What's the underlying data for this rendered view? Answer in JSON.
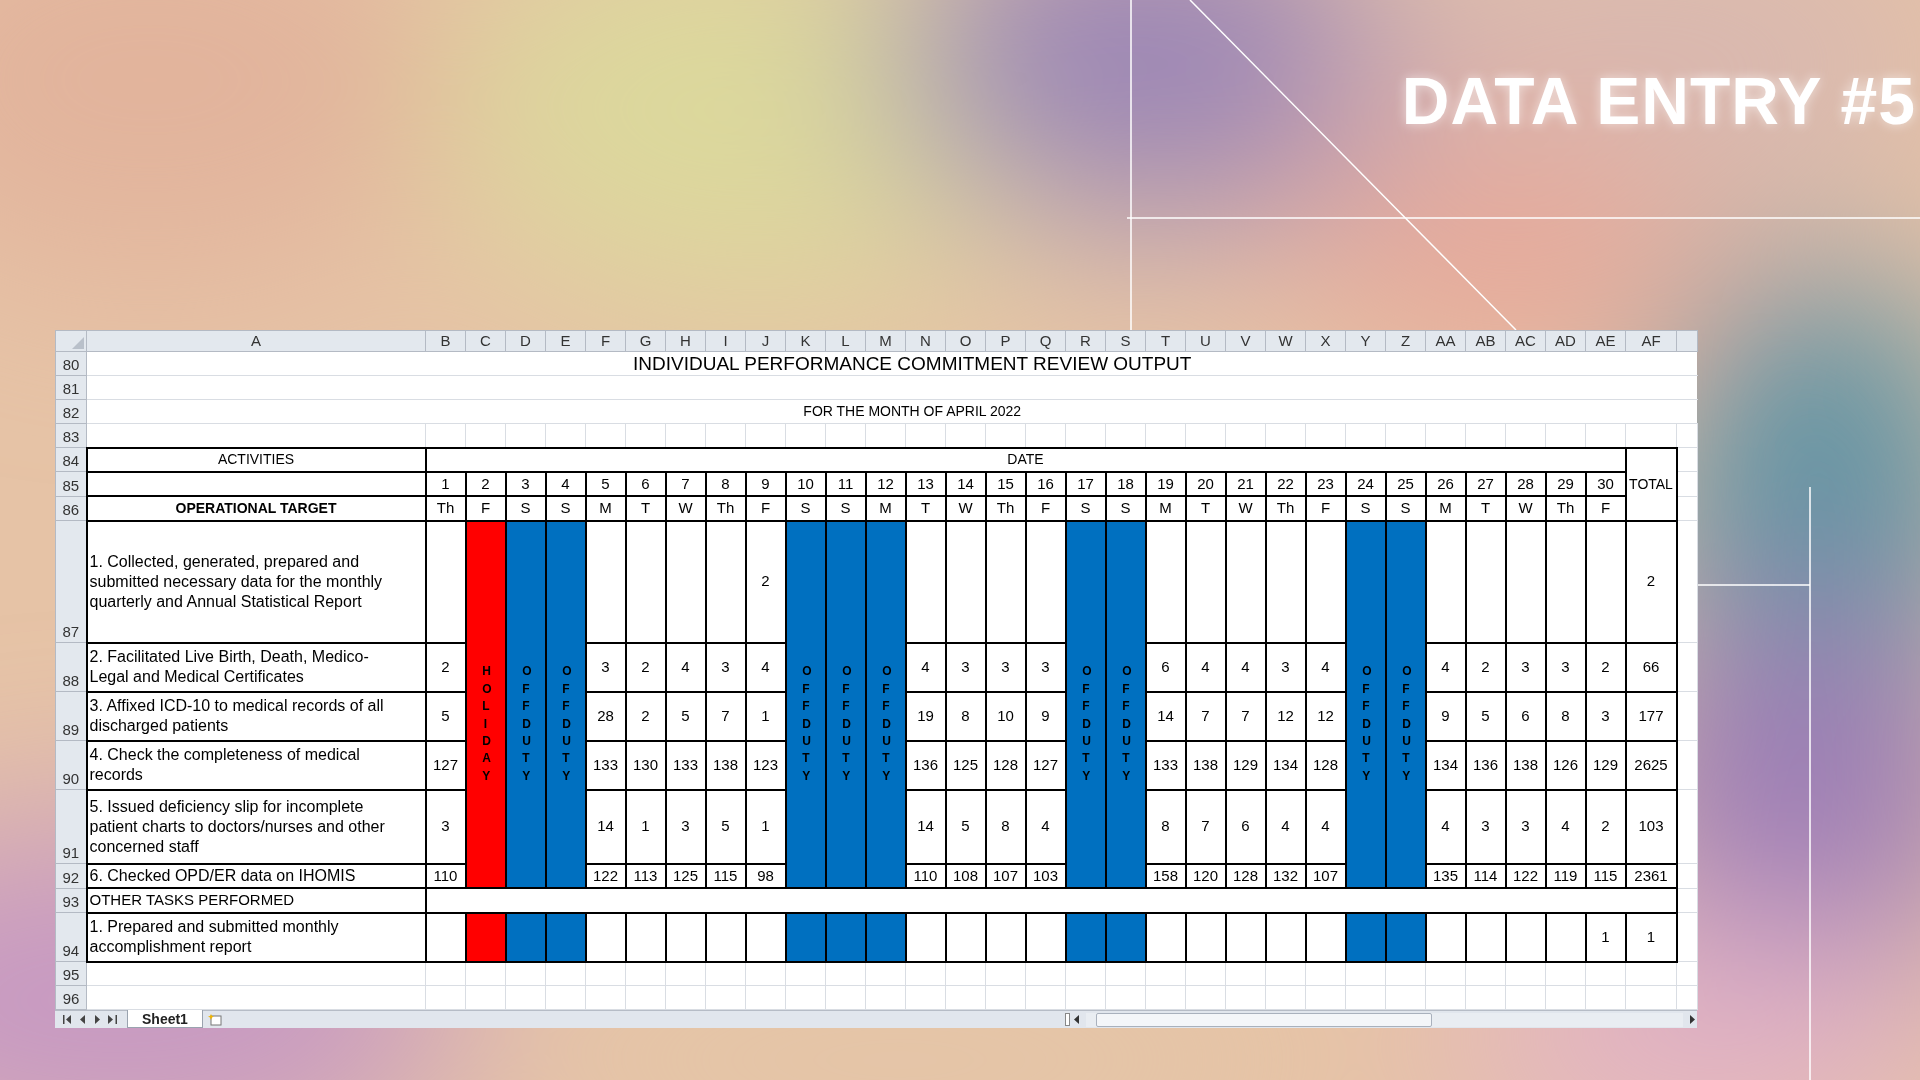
{
  "banner": {
    "title": "DATA ENTRY #5"
  },
  "sheet": {
    "columns": [
      "A",
      "B",
      "C",
      "D",
      "E",
      "F",
      "G",
      "H",
      "I",
      "J",
      "K",
      "L",
      "M",
      "N",
      "O",
      "P",
      "Q",
      "R",
      "S",
      "T",
      "U",
      "V",
      "W",
      "X",
      "Y",
      "Z",
      "AA",
      "AB",
      "AC",
      "AD",
      "AE",
      "AF"
    ],
    "row_numbers": [
      "80",
      "81",
      "82",
      "83",
      "84",
      "85",
      "86",
      "87",
      "88",
      "89",
      "90",
      "91",
      "92",
      "93",
      "94",
      "95",
      "96"
    ],
    "title": "INDIVIDUAL PERFORMANCE COMMITMENT REVIEW OUTPUT",
    "subtitle": "FOR THE MONTH OF APRIL 2022",
    "activities_header": "ACTIVITIES",
    "date_header": "DATE",
    "total_header": "TOTAL",
    "target_header": "OPERATIONAL TARGET",
    "days": [
      {
        "date": "1",
        "weekday": "Th",
        "kind": "work"
      },
      {
        "date": "2",
        "weekday": "F",
        "kind": "holiday",
        "label": "HOLIDAY"
      },
      {
        "date": "3",
        "weekday": "S",
        "kind": "off",
        "label": "OFF DUTY"
      },
      {
        "date": "4",
        "weekday": "S",
        "kind": "off",
        "label": "OFF DUTY"
      },
      {
        "date": "5",
        "weekday": "M",
        "kind": "work"
      },
      {
        "date": "6",
        "weekday": "T",
        "kind": "work"
      },
      {
        "date": "7",
        "weekday": "W",
        "kind": "work"
      },
      {
        "date": "8",
        "weekday": "Th",
        "kind": "work"
      },
      {
        "date": "9",
        "weekday": "F",
        "kind": "work"
      },
      {
        "date": "10",
        "weekday": "S",
        "kind": "off",
        "label": "OFF DUTY"
      },
      {
        "date": "11",
        "weekday": "S",
        "kind": "off",
        "label": "OFF DUTY"
      },
      {
        "date": "12",
        "weekday": "M",
        "kind": "off",
        "label": "OFF DUTY"
      },
      {
        "date": "13",
        "weekday": "T",
        "kind": "work"
      },
      {
        "date": "14",
        "weekday": "W",
        "kind": "work"
      },
      {
        "date": "15",
        "weekday": "Th",
        "kind": "work"
      },
      {
        "date": "16",
        "weekday": "F",
        "kind": "work"
      },
      {
        "date": "17",
        "weekday": "S",
        "kind": "off",
        "label": "OFF DUTY"
      },
      {
        "date": "18",
        "weekday": "S",
        "kind": "off",
        "label": "OFF DUTY"
      },
      {
        "date": "19",
        "weekday": "M",
        "kind": "work"
      },
      {
        "date": "20",
        "weekday": "T",
        "kind": "work"
      },
      {
        "date": "21",
        "weekday": "W",
        "kind": "work"
      },
      {
        "date": "22",
        "weekday": "Th",
        "kind": "work"
      },
      {
        "date": "23",
        "weekday": "F",
        "kind": "work"
      },
      {
        "date": "24",
        "weekday": "S",
        "kind": "off",
        "label": "OFF DUTY"
      },
      {
        "date": "25",
        "weekday": "S",
        "kind": "off",
        "label": "OFF DUTY"
      },
      {
        "date": "26",
        "weekday": "M",
        "kind": "work"
      },
      {
        "date": "27",
        "weekday": "T",
        "kind": "work"
      },
      {
        "date": "28",
        "weekday": "W",
        "kind": "work"
      },
      {
        "date": "29",
        "weekday": "Th",
        "kind": "work"
      },
      {
        "date": "30",
        "weekday": "F",
        "kind": "work"
      }
    ],
    "activities": [
      {
        "text": "1. Collected, generated, prepared and submitted necessary data for the monthly quarterly and Annual Statistical Report",
        "cells": [
          {
            "kind": "blank"
          },
          {
            "kind": "blank"
          },
          {
            "kind": "blank"
          },
          {
            "kind": "blank"
          },
          {
            "kind": "blank"
          },
          {
            "kind": "value",
            "value": "2"
          },
          {
            "kind": "blank"
          },
          {
            "kind": "blank"
          },
          {
            "kind": "blank"
          },
          {
            "kind": "blank"
          },
          {
            "kind": "blank"
          },
          {
            "kind": "blank"
          },
          {
            "kind": "blank"
          },
          {
            "kind": "blank"
          },
          {
            "kind": "blank"
          },
          {
            "kind": "blank"
          },
          {
            "kind": "blank"
          },
          {
            "kind": "blank"
          },
          {
            "kind": "blank"
          },
          {
            "kind": "blank"
          }
        ],
        "total": "2"
      },
      {
        "text": "2. Facilitated Live Birth, Death, Medico-Legal and Medical Certificates",
        "cells": [
          {
            "kind": "value",
            "value": "2"
          },
          {
            "kind": "value",
            "value": "3"
          },
          {
            "kind": "value",
            "value": "2"
          },
          {
            "kind": "value",
            "value": "4"
          },
          {
            "kind": "value",
            "value": "3"
          },
          {
            "kind": "value",
            "value": "4"
          },
          {
            "kind": "value",
            "value": "4"
          },
          {
            "kind": "value",
            "value": "3"
          },
          {
            "kind": "value",
            "value": "3"
          },
          {
            "kind": "value",
            "value": "3"
          },
          {
            "kind": "value",
            "value": "6"
          },
          {
            "kind": "value",
            "value": "4"
          },
          {
            "kind": "value",
            "value": "4"
          },
          {
            "kind": "value",
            "value": "3"
          },
          {
            "kind": "value",
            "value": "4"
          },
          {
            "kind": "value",
            "value": "4"
          },
          {
            "kind": "value",
            "value": "2"
          },
          {
            "kind": "value",
            "value": "3"
          },
          {
            "kind": "value",
            "value": "3"
          },
          {
            "kind": "value",
            "value": "2"
          }
        ],
        "total": "66"
      },
      {
        "text": "3. Affixed ICD-10 to medical records of all discharged patients",
        "cells": [
          {
            "kind": "value",
            "value": "5"
          },
          {
            "kind": "value",
            "value": "28"
          },
          {
            "kind": "value",
            "value": "2"
          },
          {
            "kind": "value",
            "value": "5"
          },
          {
            "kind": "value",
            "value": "7"
          },
          {
            "kind": "value",
            "value": "1"
          },
          {
            "kind": "value",
            "value": "19"
          },
          {
            "kind": "value",
            "value": "8"
          },
          {
            "kind": "value",
            "value": "10"
          },
          {
            "kind": "value",
            "value": "9"
          },
          {
            "kind": "value",
            "value": "14"
          },
          {
            "kind": "value",
            "value": "7"
          },
          {
            "kind": "value",
            "value": "7"
          },
          {
            "kind": "value",
            "value": "12"
          },
          {
            "kind": "value",
            "value": "12"
          },
          {
            "kind": "value",
            "value": "9"
          },
          {
            "kind": "value",
            "value": "5"
          },
          {
            "kind": "value",
            "value": "6"
          },
          {
            "kind": "value",
            "value": "8"
          },
          {
            "kind": "value",
            "value": "3"
          }
        ],
        "total": "177"
      },
      {
        "text": "4. Check the completeness of medical records",
        "cells": [
          {
            "kind": "value",
            "value": "127"
          },
          {
            "kind": "value",
            "value": "133"
          },
          {
            "kind": "value",
            "value": "130"
          },
          {
            "kind": "value",
            "value": "133"
          },
          {
            "kind": "value",
            "value": "138"
          },
          {
            "kind": "value",
            "value": "123"
          },
          {
            "kind": "value",
            "value": "136"
          },
          {
            "kind": "value",
            "value": "125"
          },
          {
            "kind": "value",
            "value": "128"
          },
          {
            "kind": "value",
            "value": "127"
          },
          {
            "kind": "value",
            "value": "133"
          },
          {
            "kind": "value",
            "value": "138"
          },
          {
            "kind": "value",
            "value": "129"
          },
          {
            "kind": "value",
            "value": "134"
          },
          {
            "kind": "value",
            "value": "128"
          },
          {
            "kind": "value",
            "value": "134"
          },
          {
            "kind": "value",
            "value": "136"
          },
          {
            "kind": "value",
            "value": "138"
          },
          {
            "kind": "value",
            "value": "126"
          },
          {
            "kind": "value",
            "value": "129"
          }
        ],
        "total": "2625"
      },
      {
        "text": "5. Issued deficiency slip for incomplete patient charts to doctors/nurses and other concerned staff",
        "cells": [
          {
            "kind": "value",
            "value": "3"
          },
          {
            "kind": "value",
            "value": "14"
          },
          {
            "kind": "value",
            "value": "1"
          },
          {
            "kind": "value",
            "value": "3"
          },
          {
            "kind": "value",
            "value": "5"
          },
          {
            "kind": "value",
            "value": "1"
          },
          {
            "kind": "value",
            "value": "14"
          },
          {
            "kind": "value",
            "value": "5"
          },
          {
            "kind": "value",
            "value": "8"
          },
          {
            "kind": "value",
            "value": "4"
          },
          {
            "kind": "value",
            "value": "8"
          },
          {
            "kind": "value",
            "value": "7"
          },
          {
            "kind": "value",
            "value": "6"
          },
          {
            "kind": "value",
            "value": "4"
          },
          {
            "kind": "value",
            "value": "4"
          },
          {
            "kind": "value",
            "value": "4"
          },
          {
            "kind": "value",
            "value": "3"
          },
          {
            "kind": "value",
            "value": "3"
          },
          {
            "kind": "value",
            "value": "4"
          },
          {
            "kind": "value",
            "value": "2"
          }
        ],
        "total": "103"
      },
      {
        "text": "6. Checked OPD/ER data on IHOMIS",
        "cells": [
          {
            "kind": "value",
            "value": "110"
          },
          {
            "kind": "value",
            "value": "122"
          },
          {
            "kind": "value",
            "value": "113"
          },
          {
            "kind": "value",
            "value": "125"
          },
          {
            "kind": "value",
            "value": "115"
          },
          {
            "kind": "value",
            "value": "98"
          },
          {
            "kind": "value",
            "value": "110"
          },
          {
            "kind": "value",
            "value": "108"
          },
          {
            "kind": "value",
            "value": "107"
          },
          {
            "kind": "value",
            "value": "103"
          },
          {
            "kind": "value",
            "value": "158"
          },
          {
            "kind": "value",
            "value": "120"
          },
          {
            "kind": "value",
            "value": "128"
          },
          {
            "kind": "value",
            "value": "132"
          },
          {
            "kind": "value",
            "value": "107"
          },
          {
            "kind": "value",
            "value": "135"
          },
          {
            "kind": "value",
            "value": "114"
          },
          {
            "kind": "value",
            "value": "122"
          },
          {
            "kind": "value",
            "value": "119"
          },
          {
            "kind": "value",
            "value": "115"
          }
        ],
        "total": "2361"
      }
    ],
    "other_tasks": {
      "label": "OTHER TASKS PERFORMED",
      "items": [
        {
          "text": "1. Prepared and submitted monthly accomplishment report",
          "cells": [
            {
              "kind": "blank"
            },
            {
              "kind": "blank"
            },
            {
              "kind": "blank"
            },
            {
              "kind": "blank"
            },
            {
              "kind": "blank"
            },
            {
              "kind": "blank"
            },
            {
              "kind": "blank"
            },
            {
              "kind": "blank"
            },
            {
              "kind": "blank"
            },
            {
              "kind": "blank"
            },
            {
              "kind": "blank"
            },
            {
              "kind": "blank"
            },
            {
              "kind": "blank"
            },
            {
              "kind": "blank"
            },
            {
              "kind": "blank"
            },
            {
              "kind": "blank"
            },
            {
              "kind": "blank"
            },
            {
              "kind": "blank"
            },
            {
              "kind": "blank"
            },
            {
              "kind": "value",
              "value": "1"
            }
          ],
          "total": "1"
        }
      ]
    },
    "sheet_tabs": [
      {
        "label": "Sheet1",
        "selected": true
      }
    ]
  }
}
